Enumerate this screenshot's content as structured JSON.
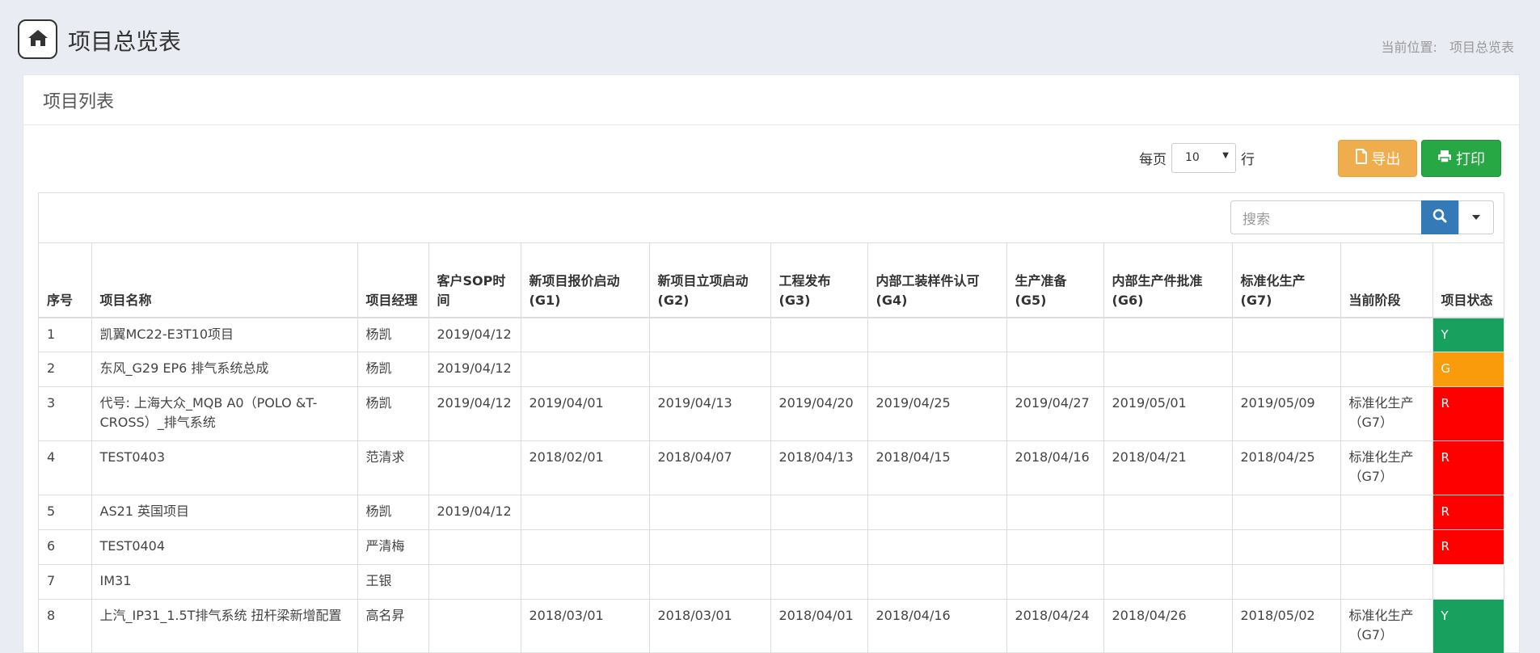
{
  "header": {
    "title": "项目总览表",
    "breadcrumb_label": "当前位置:",
    "breadcrumb_current": "项目总览表"
  },
  "panel": {
    "heading": "项目列表",
    "pager": {
      "prefix": "每页",
      "value": "10",
      "suffix": "行"
    },
    "buttons": {
      "export": "导出",
      "print": "打印"
    },
    "search": {
      "placeholder": "搜索"
    }
  },
  "colors": {
    "Y": "#17a05e",
    "G": "#f99b0b",
    "R": "#ff0000"
  },
  "table": {
    "columns": [
      "序号",
      "项目名称",
      "项目经理",
      "客户SOP时间",
      "新项目报价启动(G1)",
      "新项目立项启动(G2)",
      "工程发布(G3)",
      "内部工装样件认可(G4)",
      "生产准备(G5)",
      "内部生产件批准(G6)",
      "标准化生产(G7)",
      "当前阶段",
      "项目状态"
    ],
    "rows": [
      [
        "1",
        "凯翼MC22-E3T10项目",
        "杨凯",
        "2019/04/12",
        "",
        "",
        "",
        "",
        "",
        "",
        "",
        "",
        "Y"
      ],
      [
        "2",
        "东风_G29 EP6 排气系统总成",
        "杨凯",
        "2019/04/12",
        "",
        "",
        "",
        "",
        "",
        "",
        "",
        "",
        "G"
      ],
      [
        "3",
        "代号: 上海大众_MQB A0（POLO &T-CROSS）_排气系统",
        "杨凯",
        "2019/04/12",
        "2019/04/01",
        "2019/04/13",
        "2019/04/20",
        "2019/04/25",
        "2019/04/27",
        "2019/05/01",
        "2019/05/09",
        "标准化生产（G7）",
        "R"
      ],
      [
        "4",
        "TEST0403",
        "范清求",
        "",
        "2018/02/01",
        "2018/04/07",
        "2018/04/13",
        "2018/04/15",
        "2018/04/16",
        "2018/04/21",
        "2018/04/25",
        "标准化生产（G7）",
        "R"
      ],
      [
        "5",
        "AS21 英国项目",
        "杨凯",
        "2019/04/12",
        "",
        "",
        "",
        "",
        "",
        "",
        "",
        "",
        "R"
      ],
      [
        "6",
        "TEST0404",
        "严清梅",
        "",
        "",
        "",
        "",
        "",
        "",
        "",
        "",
        "",
        "R"
      ],
      [
        "7",
        "IM31",
        "王银",
        "",
        "",
        "",
        "",
        "",
        "",
        "",
        "",
        "",
        ""
      ],
      [
        "8",
        "上汽_IP31_1.5T排气系统 扭杆梁新增配置",
        "高名昇",
        "",
        "2018/03/01",
        "2018/03/01",
        "2018/04/01",
        "2018/04/16",
        "2018/04/24",
        "2018/04/26",
        "2018/05/02",
        "标准化生产（G7）",
        "Y"
      ]
    ]
  }
}
